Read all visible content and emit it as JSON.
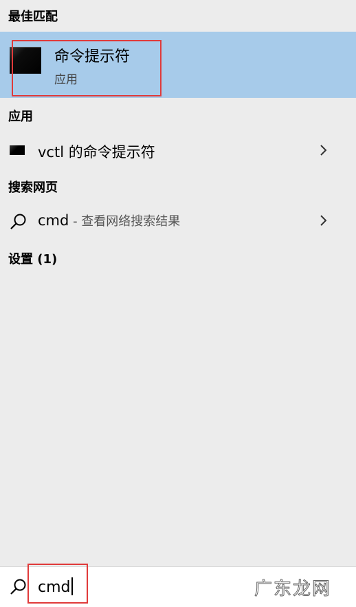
{
  "sections": {
    "best_match_header": "最佳匹配",
    "apps_header": "应用",
    "web_header": "搜索网页",
    "settings_header": "设置 (1)"
  },
  "best_match": {
    "title": "命令提示符",
    "subtitle": "应用",
    "icon": "command-prompt-icon"
  },
  "apps": [
    {
      "label": "vctl 的命令提示符",
      "icon": "command-prompt-icon"
    }
  ],
  "web": {
    "query": "cmd",
    "hint": " - 查看网络搜索结果",
    "icon": "search-icon"
  },
  "search_bar": {
    "value": "cmd"
  },
  "watermark": "广东龙网",
  "colors": {
    "panel_bg": "#ececec",
    "selected_bg": "#a7cbea",
    "annotation_red": "#e03a3a"
  }
}
